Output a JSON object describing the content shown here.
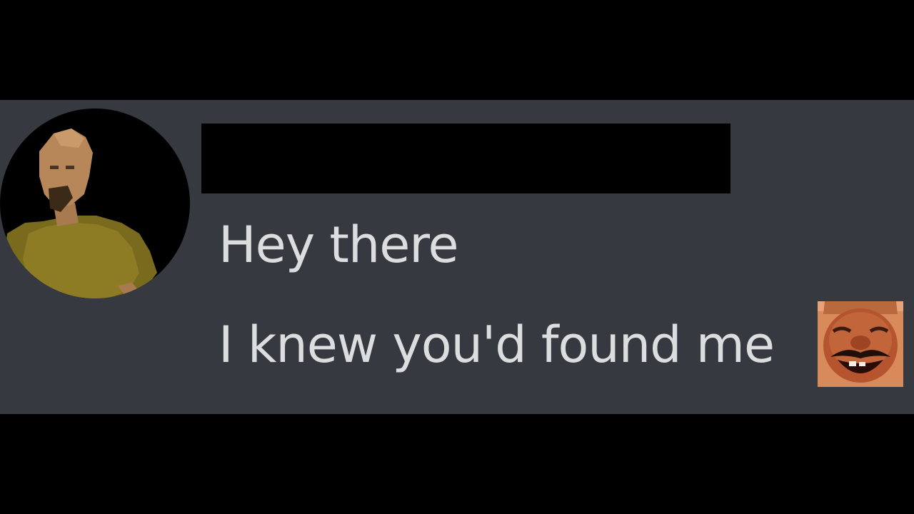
{
  "message": {
    "author": {
      "avatar_icon": "runescape-character-avatar-icon",
      "name_redacted": true
    },
    "lines": [
      {
        "text": "Hey there"
      },
      {
        "text": "I knew you'd found me",
        "emoji": "laughing-man-emoji-icon"
      }
    ]
  },
  "colors": {
    "background": "#000000",
    "panel": "#363940",
    "text": "#dcddde",
    "redaction": "#000000"
  }
}
